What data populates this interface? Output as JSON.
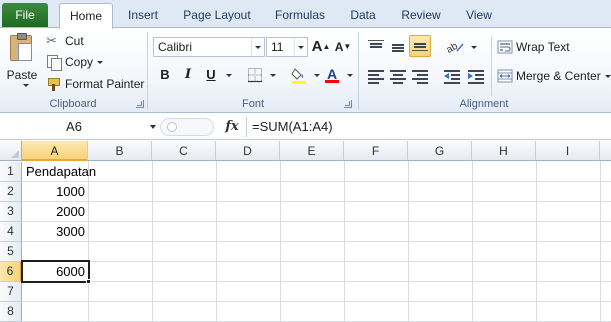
{
  "tabs": [
    {
      "label": "File"
    },
    {
      "label": "Home"
    },
    {
      "label": "Insert"
    },
    {
      "label": "Page Layout"
    },
    {
      "label": "Formulas"
    },
    {
      "label": "Data"
    },
    {
      "label": "Review"
    },
    {
      "label": "View"
    }
  ],
  "active_tab": "Home",
  "ribbon": {
    "clipboard": {
      "paste": "Paste",
      "cut": "Cut",
      "copy": "Copy",
      "format_painter": "Format Painter",
      "group_label": "Clipboard"
    },
    "font": {
      "font_name": "Calibri",
      "font_size": "11",
      "grow": "A",
      "shrink": "A",
      "bold": "B",
      "italic": "I",
      "underline": "U",
      "font_color_glyph": "A",
      "font_color": "#ff0000",
      "fill_color": "#ffff00",
      "group_label": "Font"
    },
    "alignment": {
      "wrap_text": "Wrap Text",
      "merge_center": "Merge & Center",
      "group_label": "Alignment"
    }
  },
  "formula_bar": {
    "name_box": "A6",
    "fx": "fx",
    "formula": "=SUM(A1:A4)"
  },
  "sheet": {
    "columns": [
      "A",
      "B",
      "C",
      "D",
      "E",
      "F",
      "G",
      "H",
      "I"
    ],
    "rows": [
      "1",
      "2",
      "3",
      "4",
      "5",
      "6",
      "7",
      "8"
    ],
    "selected_column": "A",
    "selected_row": "6",
    "cells": {
      "A1": "Pendapatan",
      "A2": "1000",
      "A3": "2000",
      "A4": "3000",
      "A6": "6000"
    }
  },
  "colors": {
    "file_tab": "#2a7a2f",
    "selection_header": "#f8d27a",
    "grid_line": "#dadcdd"
  }
}
